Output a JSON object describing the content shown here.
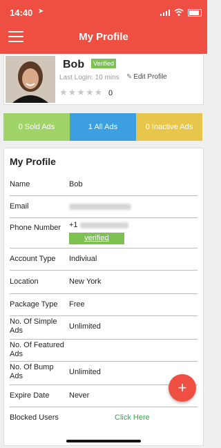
{
  "status_bar": {
    "time": "14:40"
  },
  "header": {
    "title": "My Profile"
  },
  "profile": {
    "name": "Bob",
    "badge": "Verified",
    "last_login": "Last Login: 10 mins",
    "edit_label": "Edit Profile",
    "stars": "★★★★★",
    "rating_count": "0"
  },
  "stats": {
    "sold": "0 Sold Ads",
    "all": "1 All Ads",
    "inactive": "0 Inactive Ads"
  },
  "details": {
    "section_title": "My Profile",
    "name_label": "Name",
    "name_value": "Bob",
    "email_label": "Email",
    "phone_label": "Phone Number",
    "phone_prefix": "+1",
    "phone_verified": "verified",
    "account_type_label": "Account Type",
    "account_type_value": "Indiviual",
    "location_label": "Location",
    "location_value": "New York",
    "package_type_label": "Package Type",
    "package_type_value": "Free",
    "simple_ads_label": "No. Of Simple Ads",
    "simple_ads_value": "Unlimited",
    "featured_ads_label": "No. Of Featured Ads",
    "featured_ads_value": "",
    "bump_ads_label": "No. Of Bump Ads",
    "bump_ads_value": "Unlimited",
    "expire_label": "Expire Date",
    "expire_value": "Never",
    "blocked_label": "Blocked Users",
    "blocked_link": "Click Here"
  },
  "fab": {
    "icon": "plus-icon",
    "symbol": "+"
  },
  "colors": {
    "primary": "#ef4e42",
    "sold": "#a0d468",
    "all": "#3c9fe0",
    "inactive": "#e8c64b",
    "verified": "#7cc152",
    "link": "#2eaa44"
  }
}
